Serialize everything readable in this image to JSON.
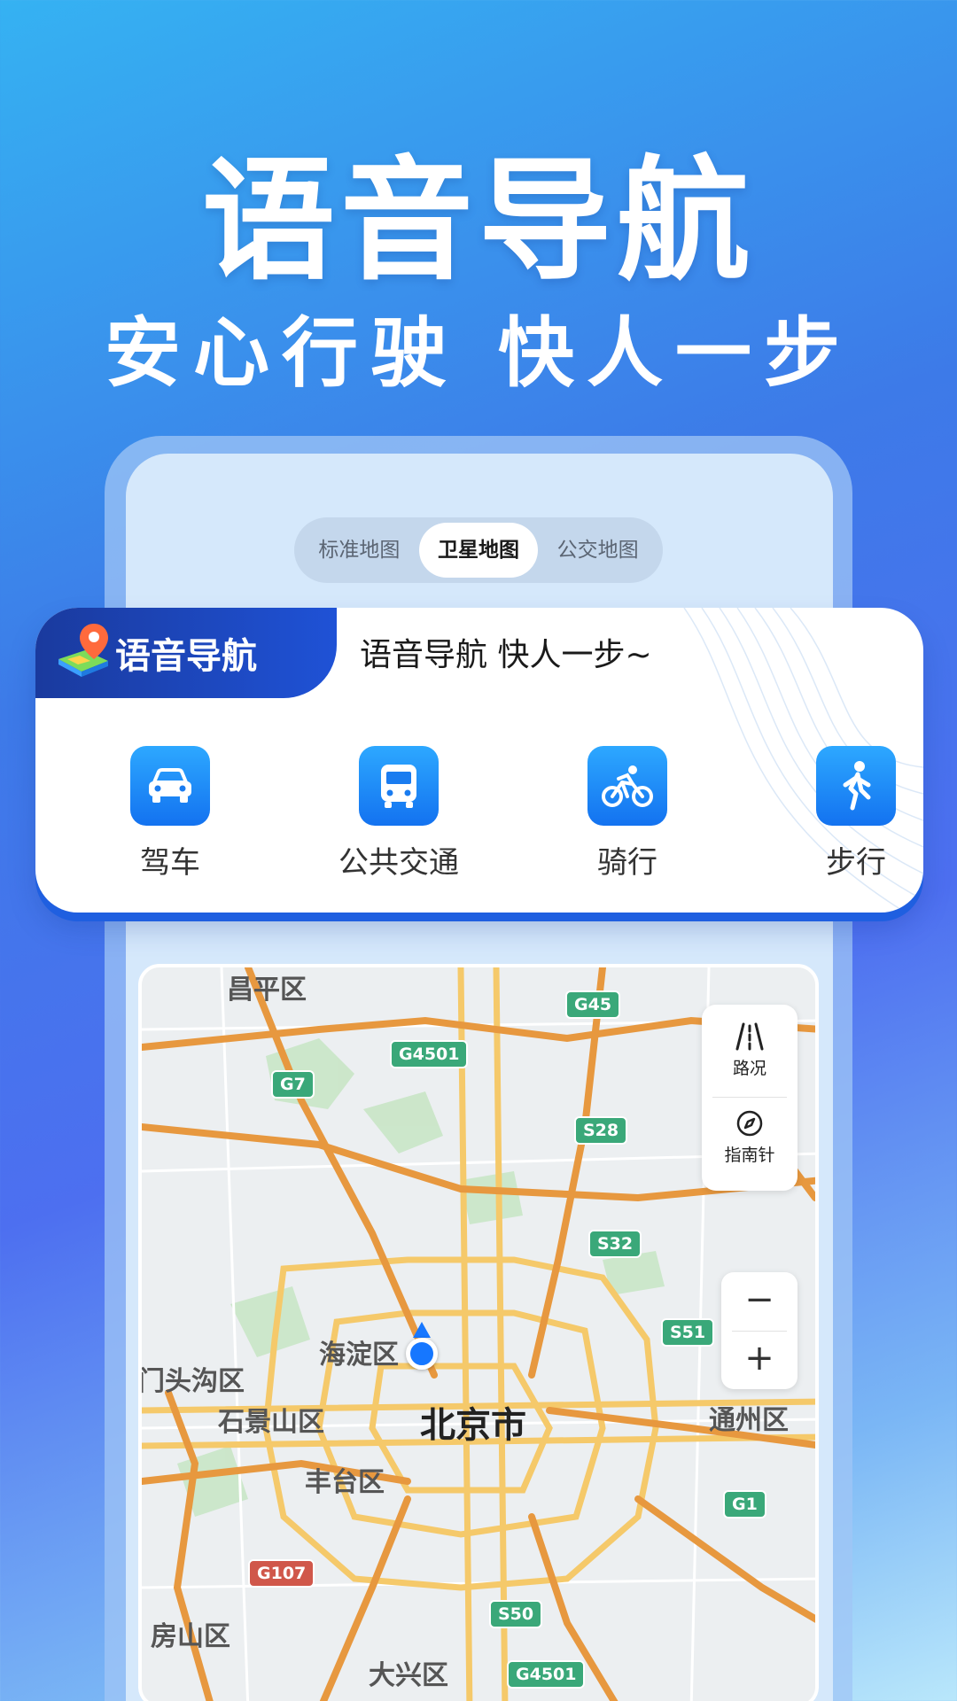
{
  "hero": {
    "title": "语音导航",
    "subtitle": "安心行驶 快人一步"
  },
  "map_modes": {
    "options": [
      "标准地图",
      "卫星地图",
      "公交地图"
    ],
    "selected": "卫星地图"
  },
  "nav_card": {
    "tag": "语音导航",
    "slogan": "语音导航 快人一步~",
    "modes": [
      {
        "label": "驾车",
        "icon": "car-icon"
      },
      {
        "label": "公共交通",
        "icon": "bus-icon"
      },
      {
        "label": "骑行",
        "icon": "bicycle-icon"
      },
      {
        "label": "步行",
        "icon": "walk-icon"
      }
    ]
  },
  "map": {
    "city": "北京市",
    "districts": [
      "昌平区",
      "海淀区",
      "门头沟区",
      "石景山区",
      "丰台区",
      "通州区",
      "房山区",
      "大兴区"
    ],
    "shields": [
      "G45",
      "G4501",
      "G7",
      "S28",
      "S32",
      "S51",
      "G1",
      "G107",
      "S50",
      "G4501"
    ],
    "tools": {
      "traffic": "路况",
      "compass": "指南针"
    },
    "zoom": {
      "out": "−",
      "in": "+"
    }
  },
  "colors": {
    "accent": "#1f5fe0",
    "icon_gradient_top": "#2da8ff",
    "icon_gradient_bottom": "#1372f0",
    "location": "#1677ff"
  }
}
